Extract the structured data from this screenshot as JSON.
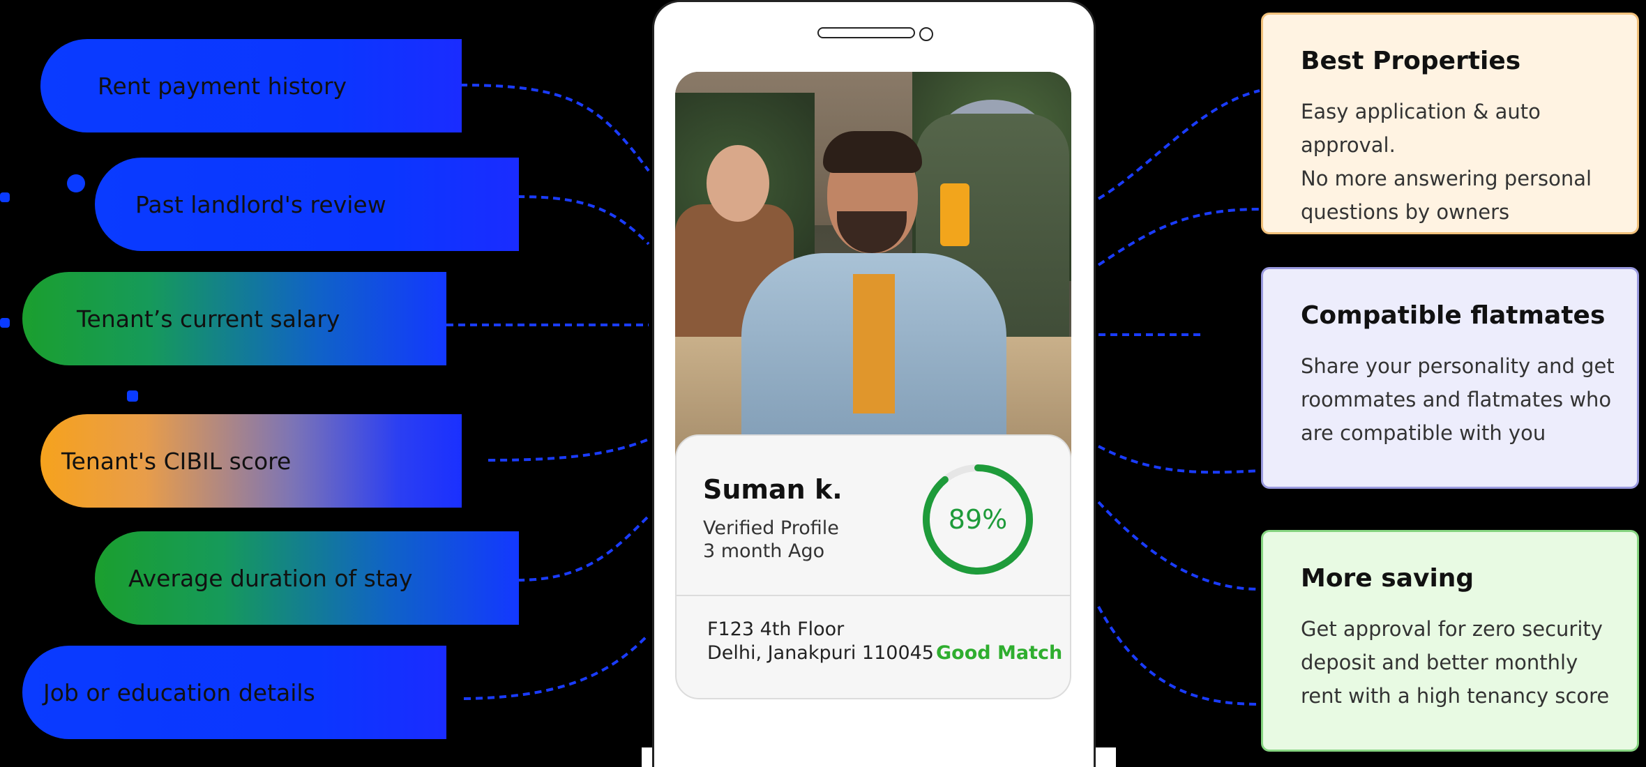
{
  "features": [
    {
      "label": "Rent payment history"
    },
    {
      "label": "Past landlord's review"
    },
    {
      "label": "Tenant’s current salary"
    },
    {
      "label": "Tenant's CIBIL score"
    },
    {
      "label": "Average duration of stay"
    },
    {
      "label": "Job or education details"
    }
  ],
  "profile": {
    "name": "Suman k.",
    "status": "Verified Profile",
    "time": "3 month Ago",
    "match_percent": "89%",
    "match_value": 0.89,
    "address_line1": "F123 4th Floor",
    "address_line2": "Delhi, Janakpuri 110045",
    "match_label": "Good Match"
  },
  "benefits": [
    {
      "title": "Best Properties",
      "text": "Easy application & auto approval.\nNo more answering personal\nquestions by owners"
    },
    {
      "title": "Compatible flatmates",
      "text": "Share your personality and get\nroommates and flatmates who\nare compatible with you"
    },
    {
      "title": "More saving",
      "text": "Get approval for zero security\ndeposit and better monthly\nrent with a high tenancy score"
    }
  ],
  "colors": {
    "accent_blue": "#0a3bff",
    "accent_green": "#1e9b3a",
    "match_green": "#2fae2f"
  }
}
